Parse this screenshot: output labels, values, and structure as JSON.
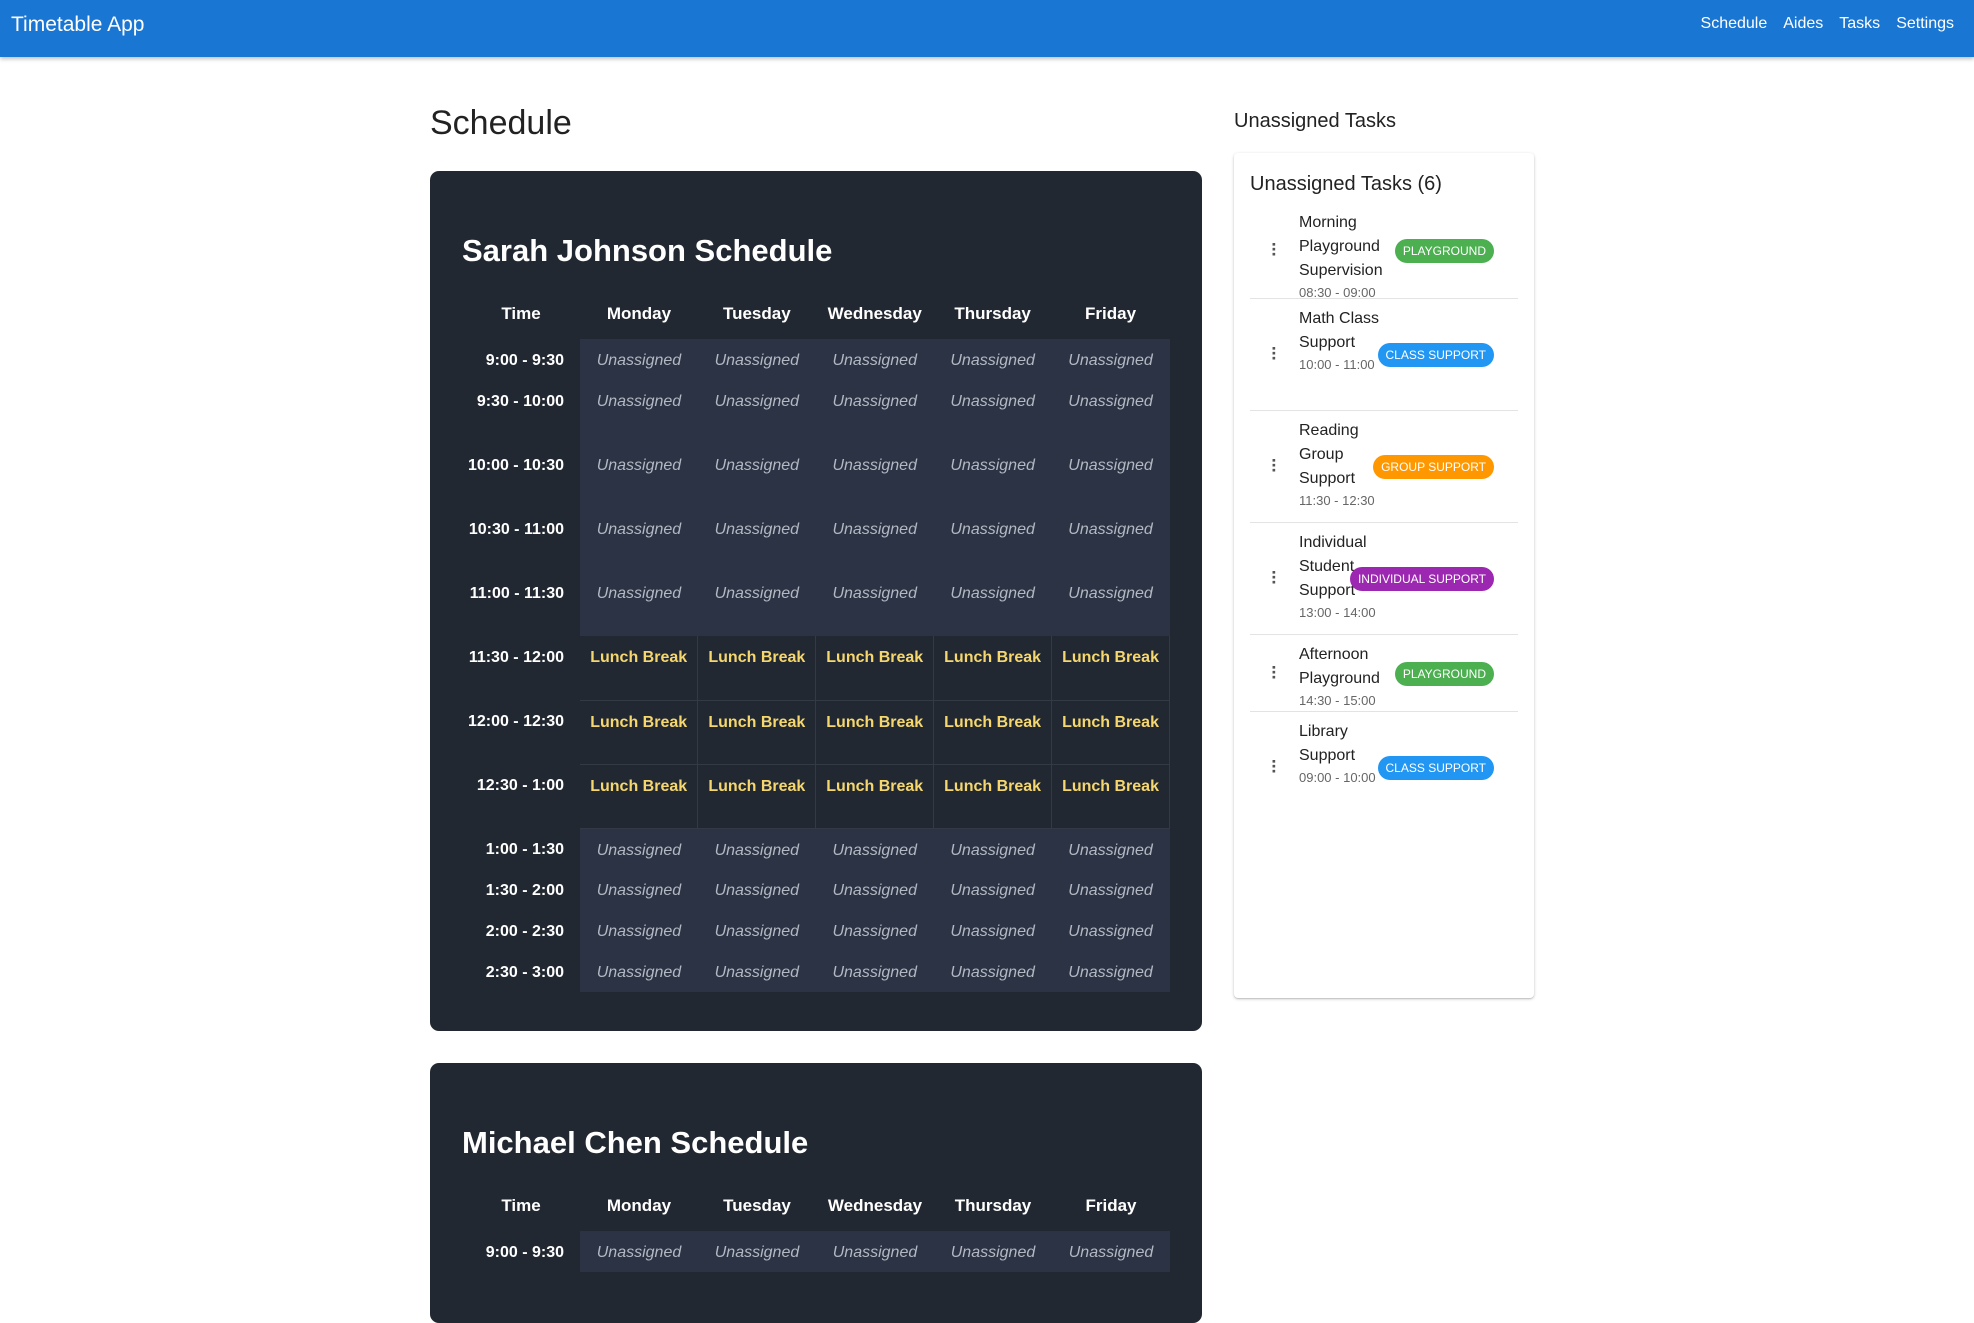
{
  "app": {
    "title": "Timetable App",
    "nav": [
      "Schedule",
      "Aides",
      "Tasks",
      "Settings"
    ]
  },
  "page_title": "Schedule",
  "schedules": [
    {
      "title": "Sarah Johnson Schedule",
      "headers": [
        "Time",
        "Monday",
        "Tuesday",
        "Wednesday",
        "Thursday",
        "Friday"
      ],
      "rows": [
        {
          "time": "9:00 - 9:30",
          "cells": [
            "Unassigned",
            "Unassigned",
            "Unassigned",
            "Unassigned",
            "Unassigned"
          ]
        },
        {
          "time": "9:30 - 10:00",
          "cells": [
            "Unassigned",
            "Unassigned",
            "Unassigned",
            "Unassigned",
            "Unassigned"
          ]
        },
        {
          "time": "10:00 - 10:30",
          "cells": [
            "Unassigned",
            "Unassigned",
            "Unassigned",
            "Unassigned",
            "Unassigned"
          ]
        },
        {
          "time": "10:30 - 11:00",
          "cells": [
            "Unassigned",
            "Unassigned",
            "Unassigned",
            "Unassigned",
            "Unassigned"
          ]
        },
        {
          "time": "11:00 - 11:30",
          "cells": [
            "Unassigned",
            "Unassigned",
            "Unassigned",
            "Unassigned",
            "Unassigned"
          ]
        },
        {
          "time": "11:30 - 12:00",
          "cells": [
            "Lunch Break",
            "Lunch Break",
            "Lunch Break",
            "Lunch Break",
            "Lunch Break"
          ]
        },
        {
          "time": "12:00 - 12:30",
          "cells": [
            "Lunch Break",
            "Lunch Break",
            "Lunch Break",
            "Lunch Break",
            "Lunch Break"
          ]
        },
        {
          "time": "12:30 - 1:00",
          "cells": [
            "Lunch Break",
            "Lunch Break",
            "Lunch Break",
            "Lunch Break",
            "Lunch Break"
          ]
        },
        {
          "time": "1:00 - 1:30",
          "cells": [
            "Unassigned",
            "Unassigned",
            "Unassigned",
            "Unassigned",
            "Unassigned"
          ]
        },
        {
          "time": "1:30 - 2:00",
          "cells": [
            "Unassigned",
            "Unassigned",
            "Unassigned",
            "Unassigned",
            "Unassigned"
          ]
        },
        {
          "time": "2:00 - 2:30",
          "cells": [
            "Unassigned",
            "Unassigned",
            "Unassigned",
            "Unassigned",
            "Unassigned"
          ]
        },
        {
          "time": "2:30 - 3:00",
          "cells": [
            "Unassigned",
            "Unassigned",
            "Unassigned",
            "Unassigned",
            "Unassigned"
          ]
        }
      ]
    },
    {
      "title": "Michael Chen Schedule",
      "headers": [
        "Time",
        "Monday",
        "Tuesday",
        "Wednesday",
        "Thursday",
        "Friday"
      ],
      "rows": [
        {
          "time": "9:00 - 9:30",
          "cells": [
            "Unassigned",
            "Unassigned",
            "Unassigned",
            "Unassigned",
            "Unassigned"
          ]
        }
      ]
    }
  ],
  "unassigned": {
    "heading": "Unassigned Tasks",
    "card_title": "Unassigned Tasks (6)",
    "tasks": [
      {
        "name": "Morning Playground Supervision",
        "time": "08:30 - 09:00",
        "chip": "PLAYGROUND",
        "color": "#4caf50"
      },
      {
        "name": "Math Class Support",
        "time": "10:00 - 11:00",
        "chip": "CLASS SUPPORT",
        "color": "#2196f3"
      },
      {
        "name": "Reading Group Support",
        "time": "11:30 - 12:30",
        "chip": "GROUP SUPPORT",
        "color": "#ff9800"
      },
      {
        "name": "Individual Student Support",
        "time": "13:00 - 14:00",
        "chip": "INDIVIDUAL SUPPORT",
        "color": "#9c27b0"
      },
      {
        "name": "Afternoon Playground",
        "time": "14:30 - 15:00",
        "chip": "PLAYGROUND",
        "color": "#4caf50"
      },
      {
        "name": "Library Support",
        "time": "09:00 - 10:00",
        "chip": "CLASS SUPPORT",
        "color": "#2196f3"
      }
    ]
  }
}
